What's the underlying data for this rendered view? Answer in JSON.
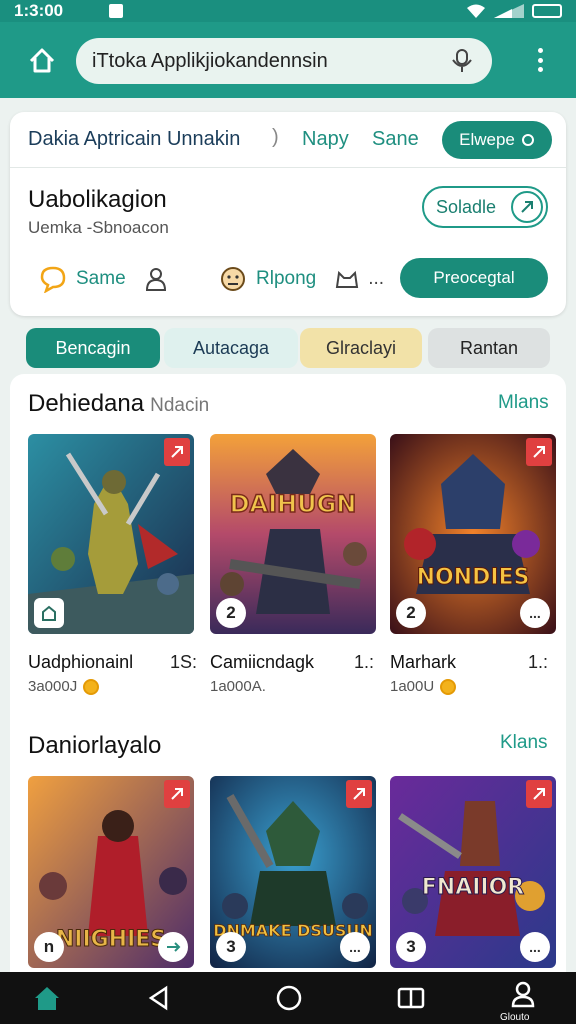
{
  "status": {
    "time": "1:3:00"
  },
  "search": {
    "query": "iTtoka Applikjiokandennsin"
  },
  "app_card": {
    "tabs": [
      "Dakia Aptricain Unnakin",
      "Napy",
      "Sane"
    ],
    "tab_separator": ")",
    "tab_button": "Elwepe",
    "app_name": "Uabolikagion",
    "app_sub": "Uemka -Sbnoacon",
    "install_label": "Soladle",
    "actions": [
      "Same",
      "Rlpong"
    ],
    "actions_more": "...",
    "primary_button": "Preocegtal"
  },
  "chips": [
    "Bencagin",
    "Autacaga",
    "Glraclayi",
    "Rantan"
  ],
  "sections": [
    {
      "title": "Dehiedana",
      "subtitle": "Ndacin",
      "more": "Mlans",
      "tiles": [
        {
          "title": "Uadphionainl",
          "rank": "1S:",
          "meta": "3a000J",
          "badge": "",
          "more": ""
        },
        {
          "title": "Camiicndagk",
          "rank": "1.:",
          "meta": "1a000A.",
          "badge": "2",
          "more": ""
        },
        {
          "title": "Marhark",
          "rank": "1.:",
          "meta": "1a00U",
          "badge": "2",
          "more": "..."
        }
      ]
    },
    {
      "title": "Daniorlayalo",
      "subtitle": "",
      "more": "Klans",
      "tiles": [
        {
          "title": "",
          "rank": "",
          "meta": "",
          "badge": "n",
          "more": ""
        },
        {
          "title": "",
          "rank": "",
          "meta": "",
          "badge": "3",
          "more": "..."
        },
        {
          "title": "",
          "rank": "",
          "meta": "",
          "badge": "3",
          "more": "..."
        }
      ]
    }
  ],
  "artwork_text": [
    "DAIHUGN",
    "NONDIES",
    "NIIGHIES",
    "DNMAKE DSUSUN",
    "FNAIIOR"
  ],
  "nav": {
    "profile_label": "Glouto"
  },
  "colors": {
    "primary": "#1f9a88",
    "accent_dark": "#1a8c7a",
    "chip_yellow": "#f2e2a8",
    "flag_red": "#e04040"
  }
}
